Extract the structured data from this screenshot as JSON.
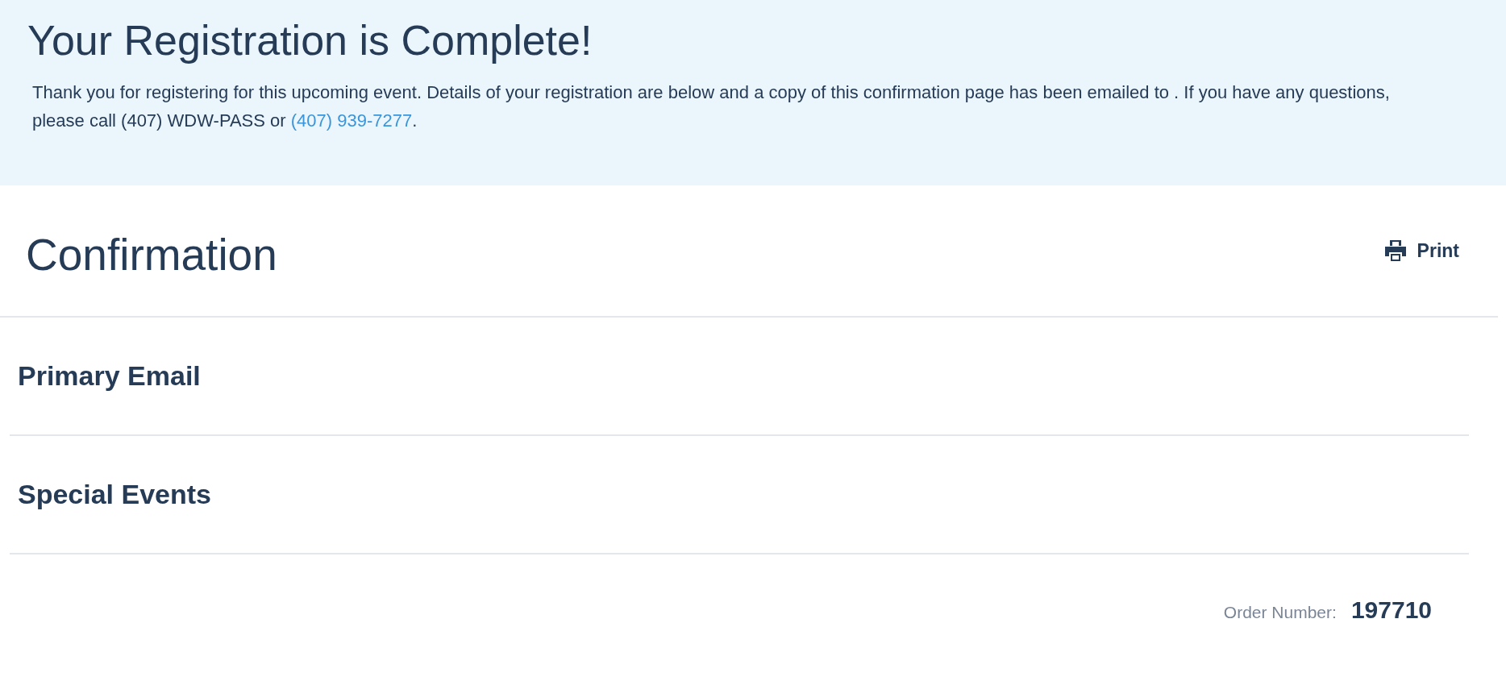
{
  "banner": {
    "title": "Your Registration is Complete!",
    "message": {
      "before": "Thank you for registering for this upcoming event. Details of your registration are below and a copy of this confirmation page has been emailed to . If you have any questions, please call (407) WDW-PASS or ",
      "link": "(407) 939-7277",
      "after": "."
    }
  },
  "confirmation": {
    "title": "Confirmation",
    "print_label": "Print"
  },
  "sections": [
    {
      "title": "Primary Email"
    },
    {
      "title": "Special Events"
    }
  ],
  "order": {
    "label": "Order Number:",
    "value": "197710"
  }
}
